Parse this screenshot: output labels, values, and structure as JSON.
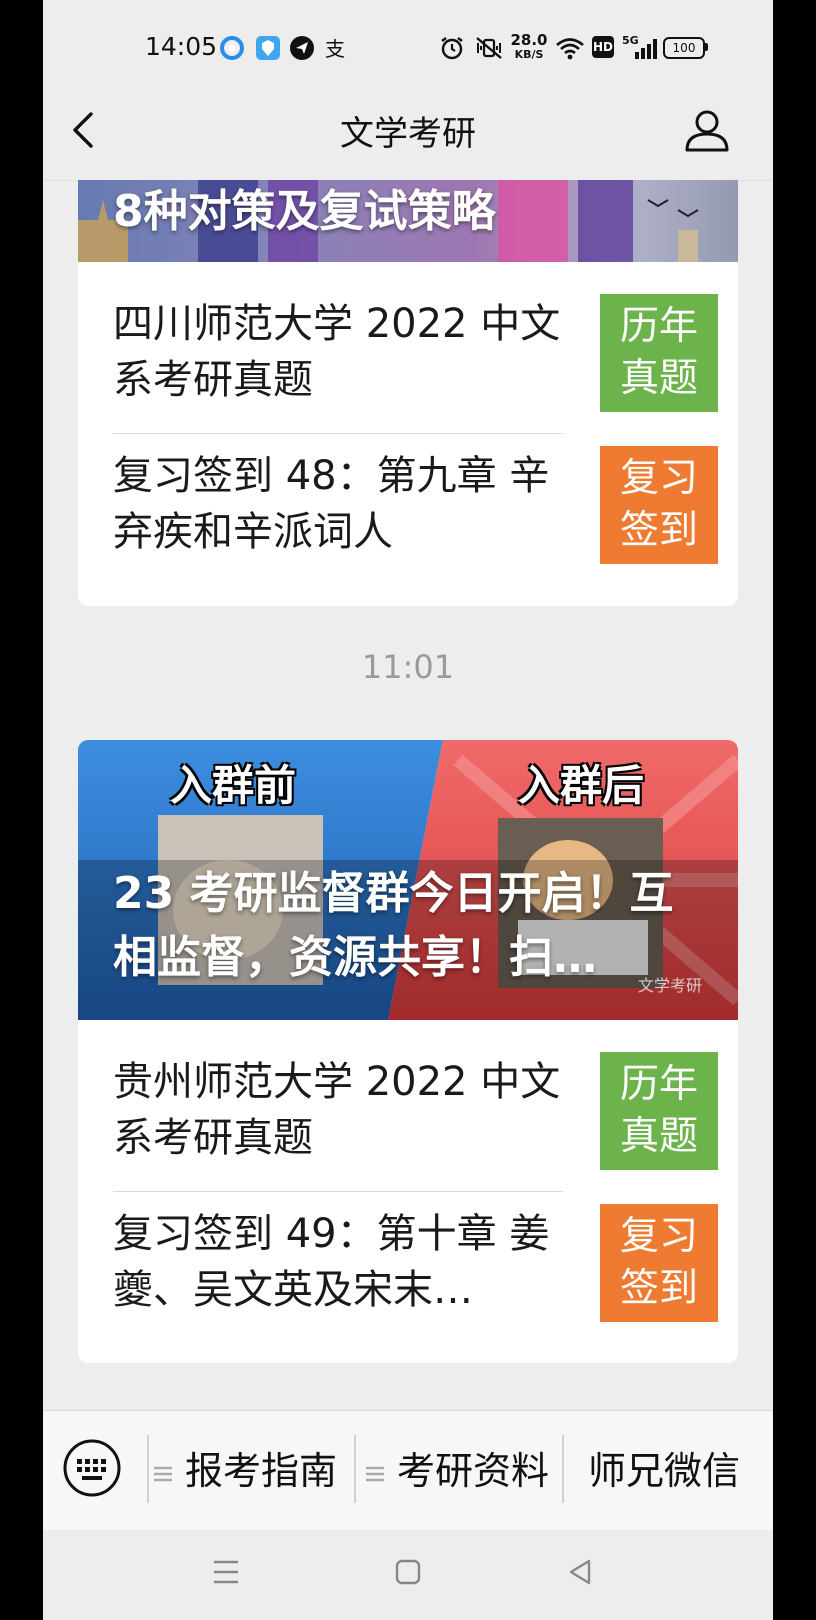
{
  "status_bar": {
    "time": "14:05",
    "net_speed_value": "28.0",
    "net_speed_unit": "KB/S",
    "hd": "HD",
    "signal": "5G",
    "battery": "100"
  },
  "nav": {
    "title": "文学考研"
  },
  "top_card": {
    "banner_text": "8种对策及复试策略",
    "items": [
      {
        "title": "四川师范大学 2022 中文系考研真题",
        "thumb_line1": "历年",
        "thumb_line2": "真题"
      },
      {
        "title": "复习签到 48：第九章 辛弃疾和辛派词人",
        "thumb_line1": "复习",
        "thumb_line2": "签到"
      }
    ]
  },
  "timestamp": "11:01",
  "second_card": {
    "banner_left_label": "入群前",
    "banner_right_label": "入群后",
    "banner_text": "23 考研监督群今日开启！互相监督，资源共享！扫…",
    "banner_watermark": "文学考研",
    "items": [
      {
        "title": "贵州师范大学 2022 中文系考研真题",
        "thumb_line1": "历年",
        "thumb_line2": "真题"
      },
      {
        "title": "复习签到 49：第十章 姜夔、吴文英及宋末…",
        "thumb_line1": "复习",
        "thumb_line2": "签到"
      }
    ]
  },
  "menu": {
    "items": [
      {
        "label": "报考指南"
      },
      {
        "label": "考研资料"
      },
      {
        "label": "师兄微信"
      }
    ]
  },
  "colors": {
    "green": "#6db34b",
    "orange": "#ef7b32",
    "background": "#ededed"
  }
}
